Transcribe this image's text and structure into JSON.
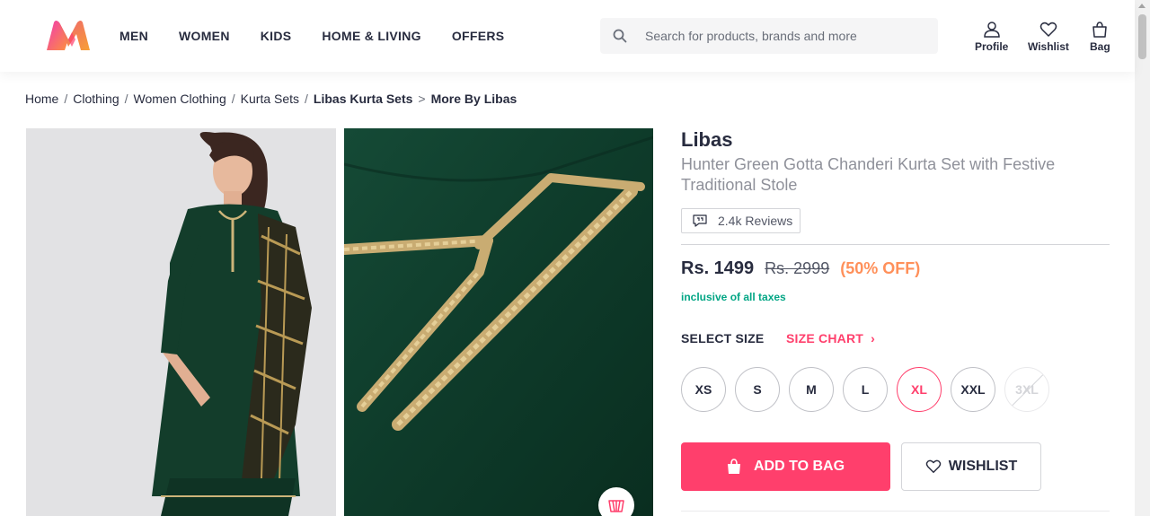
{
  "header": {
    "nav": [
      "MEN",
      "WOMEN",
      "KIDS",
      "HOME & LIVING",
      "OFFERS"
    ],
    "search_placeholder": "Search for products, brands and more",
    "profile_label": "Profile",
    "wishlist_label": "Wishlist",
    "bag_label": "Bag"
  },
  "breadcrumb": [
    "Home",
    "Clothing",
    "Women Clothing",
    "Kurta Sets",
    "Libas Kurta Sets",
    "More By Libas"
  ],
  "product": {
    "brand": "Libas",
    "name": "Hunter Green Gotta Chanderi Kurta Set with Festive Traditional Stole",
    "reviews": "2.4k Reviews",
    "price": "Rs. 1499",
    "mrp": "Rs. 2999",
    "discount": "(50% OFF)",
    "tax_note": "inclusive of all taxes"
  },
  "size": {
    "heading": "SELECT SIZE",
    "chart_label": "SIZE CHART",
    "options": [
      "XS",
      "S",
      "M",
      "L",
      "XL",
      "XXL",
      "3XL"
    ],
    "selected": "XL",
    "unavailable": [
      "3XL"
    ]
  },
  "actions": {
    "add_to_bag": "ADD TO BAG",
    "wishlist": "WISHLIST"
  },
  "colors": {
    "brand_pink": "#ff3f6c",
    "discount_orange": "#ff905a",
    "tax_green": "#03a685",
    "kurta_green": "#0f3b2c"
  }
}
